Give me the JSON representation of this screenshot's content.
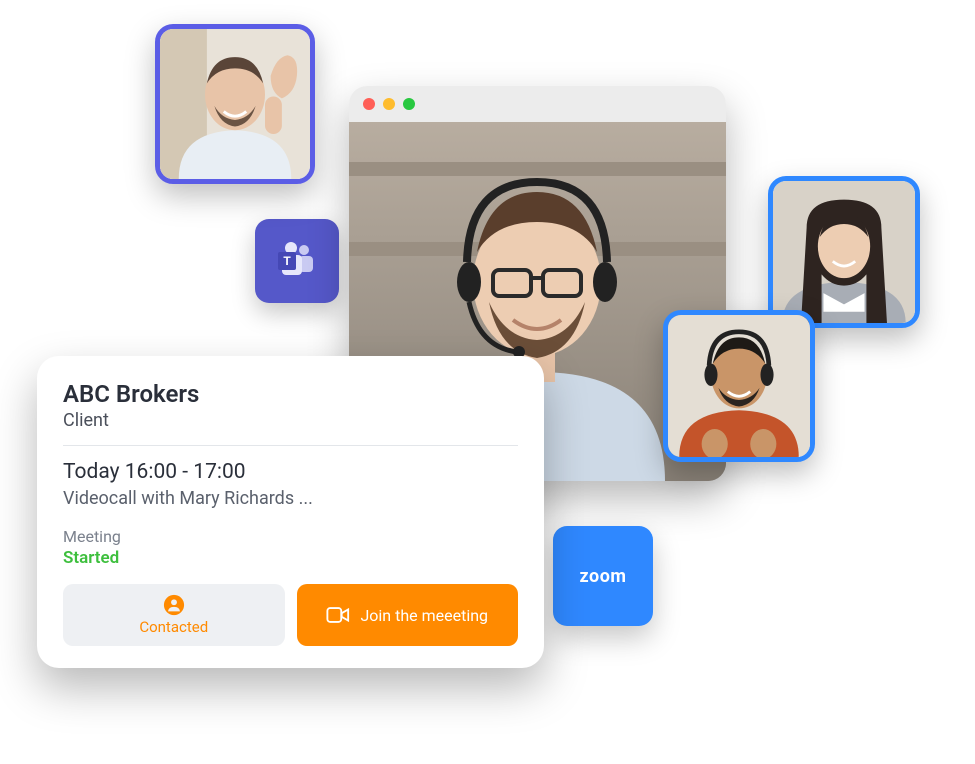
{
  "teams": {
    "label": "T"
  },
  "zoom": {
    "label": "zoom"
  },
  "card": {
    "title": "ABC Brokers",
    "subtitle": "Client",
    "time": "Today 16:00 - 17:00",
    "description": "Videocall with  Mary Richards ...",
    "meeting_label": "Meeting",
    "status": "Started",
    "contacted_label": "Contacted",
    "join_label": "Join the meeeting"
  },
  "avatars": {
    "topLeft": "man-waving",
    "right1": "woman-smiling",
    "right2": "man-headset-orange",
    "main": "man-glasses-headset"
  },
  "colors": {
    "purple": "#5B5DE6",
    "blue": "#2F88FF",
    "orange": "#FF8A00",
    "green": "#3DBF3D"
  }
}
